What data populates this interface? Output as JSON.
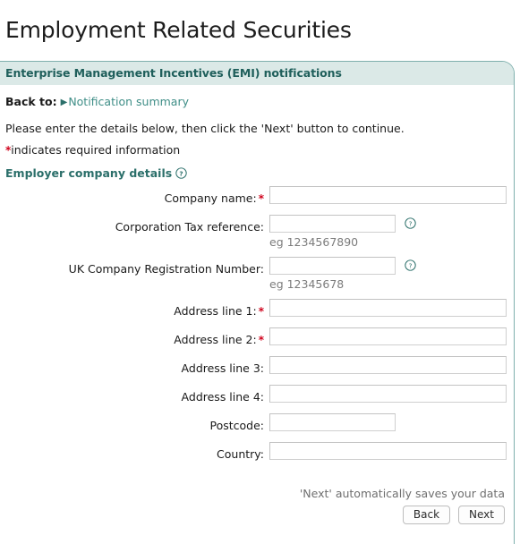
{
  "page": {
    "title": "Employment Related Securities",
    "subtitle": "Enterprise Management Incentives (EMI) notifications"
  },
  "breadcrumb": {
    "label": "Back to:",
    "arrow": "▶",
    "link": "Notification summary"
  },
  "intro": {
    "instruction": "Please enter the details below, then click the 'Next' button to continue.",
    "required_star": "*",
    "required_note": "indicates required information"
  },
  "section": {
    "heading": "Employer company details",
    "help_icon": "question-mark-circle-icon"
  },
  "form": {
    "required_marker": "*",
    "fields": [
      {
        "label": "Company name:",
        "required": true,
        "value": "",
        "width": "full",
        "help": false,
        "hint": ""
      },
      {
        "label": "Corporation Tax reference:",
        "required": false,
        "value": "",
        "width": "med",
        "help": true,
        "hint": "eg 1234567890"
      },
      {
        "label": "UK Company Registration Number:",
        "required": false,
        "value": "",
        "width": "med",
        "help": true,
        "hint": "eg 12345678"
      },
      {
        "label": "Address line 1:",
        "required": true,
        "value": "",
        "width": "full",
        "help": false,
        "hint": ""
      },
      {
        "label": "Address line 2:",
        "required": true,
        "value": "",
        "width": "full",
        "help": false,
        "hint": ""
      },
      {
        "label": "Address line 3:",
        "required": false,
        "value": "",
        "width": "full",
        "help": false,
        "hint": ""
      },
      {
        "label": "Address line 4:",
        "required": false,
        "value": "",
        "width": "full",
        "help": false,
        "hint": ""
      },
      {
        "label": "Postcode:",
        "required": false,
        "value": "",
        "width": "post",
        "help": false,
        "hint": ""
      },
      {
        "label": "Country:",
        "required": false,
        "value": "",
        "width": "full",
        "help": false,
        "hint": ""
      }
    ]
  },
  "footer": {
    "save_note": "'Next' automatically saves your data",
    "back_button": "Back",
    "next_button": "Next"
  },
  "colors": {
    "accent_teal": "#2b6f6a",
    "link_teal": "#3f8e87",
    "subtitle_bg": "#dbe9e7",
    "border_teal": "#7fb0ad",
    "required_red": "#d0021b",
    "hint_gray": "#7c7c7c"
  }
}
